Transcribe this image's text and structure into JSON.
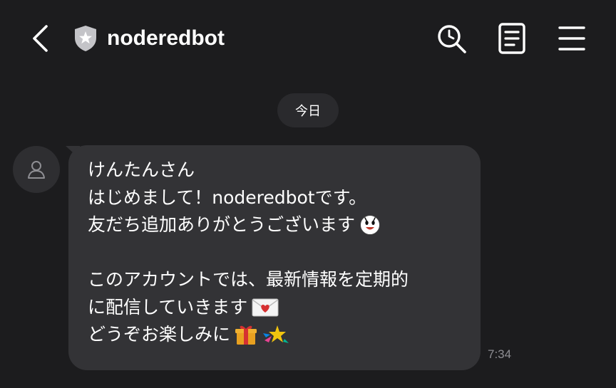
{
  "header": {
    "title": "noderedbot",
    "icons": [
      "back-arrow-icon",
      "official-badge-icon",
      "search-icon",
      "notes-icon",
      "menu-icon"
    ]
  },
  "chat": {
    "date_label": "今日",
    "message": {
      "lines": [
        "けんたんさん",
        "はじめまして！noderedbotです。",
        "友だち追加ありがとうございます",
        "",
        "このアカウントでは、最新情報を定期的",
        "に配信していきます",
        "どうぞお楽しみに"
      ],
      "emojis": [
        "smiling-face-emoji",
        "love-letter-emoji",
        "gift-emoji",
        "shooting-star-emoji"
      ],
      "time": "7:34"
    }
  },
  "colors": {
    "background": "#1c1c1e",
    "bubble": "#333336",
    "date_chip": "#2a2a2d",
    "timestamp": "#8e8e93"
  }
}
